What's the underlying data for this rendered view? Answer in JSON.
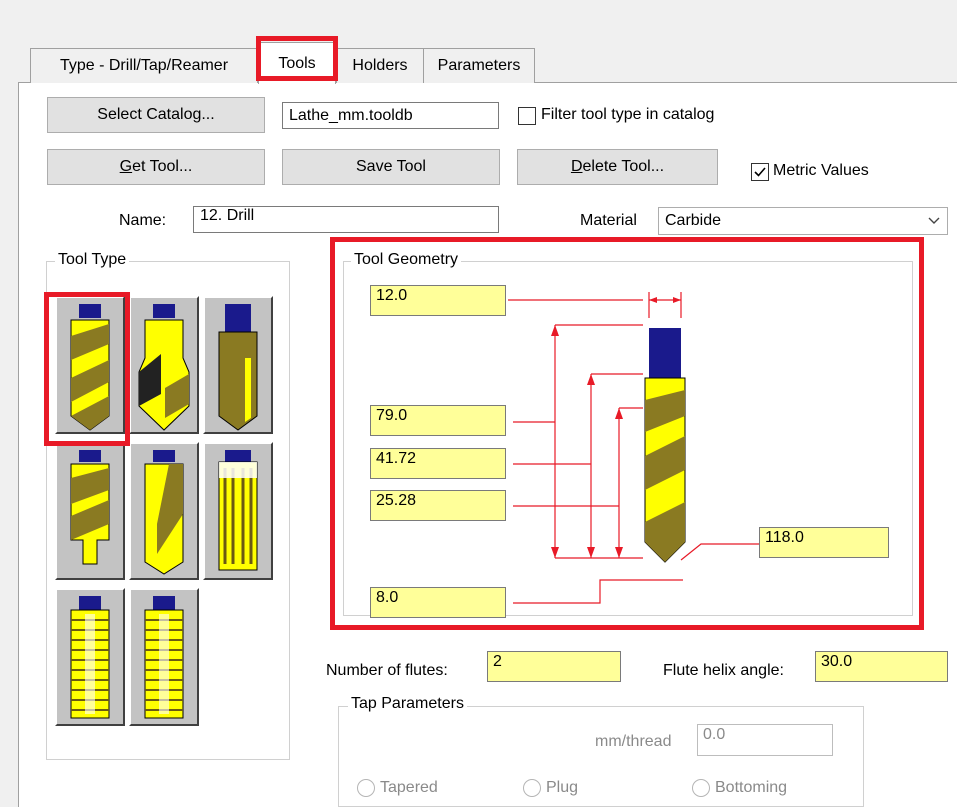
{
  "tabs": [
    {
      "label": "Type - Drill/Tap/Reamer"
    },
    {
      "label": "Tools"
    },
    {
      "label": "Holders"
    },
    {
      "label": "Parameters"
    }
  ],
  "active_tab": "Tools",
  "catalog": {
    "select_label": "Select Catalog...",
    "file_value": "Lathe_mm.tooldb",
    "filter_label": "Filter tool type in catalog",
    "filter_checked": false
  },
  "tool_actions": {
    "get_tool_label_rest": "et Tool...",
    "get_tool_accel": "G",
    "save_tool_label": "Save Tool",
    "delete_tool_accel": "D",
    "delete_tool_label_rest": "elete Tool...",
    "metric_label": "Metric Values",
    "metric_checked": true
  },
  "name": {
    "label": "Name:",
    "value": "12. Drill"
  },
  "material": {
    "label": "Material",
    "selected": "Carbide"
  },
  "tool_type": {
    "title": "Tool Type",
    "tiles": [
      {
        "icon": "drill-icon"
      },
      {
        "icon": "spot-drill-icon"
      },
      {
        "icon": "end-mill-icon"
      },
      {
        "icon": "step-drill-icon"
      },
      {
        "icon": "twist-drill-icon"
      },
      {
        "icon": "reamer-icon"
      },
      {
        "icon": "tap-icon"
      },
      {
        "icon": "tap-bottoming-icon"
      }
    ]
  },
  "geometry": {
    "title": "Tool Geometry",
    "diameter": "12.0",
    "overall_length": "79.0",
    "shoulder_length": "41.72",
    "flute_length": "25.28",
    "point_angle": "118.0",
    "tip_diameter": "8.0"
  },
  "flutes": {
    "count_label": "Number of flutes:",
    "count": "2",
    "helix_label": "Flute helix angle:",
    "helix": "30.0"
  },
  "tap": {
    "title": "Tap Parameters",
    "thread_label": "mm/thread",
    "thread_value": "0.0",
    "options": [
      {
        "label": "Tapered"
      },
      {
        "label": "Plug"
      },
      {
        "label": "Bottoming"
      }
    ]
  },
  "colors": {
    "highlight": "#e81a27",
    "field_yellow": "#ffff99",
    "drill_yellow": "#ffff00",
    "shank_blue": "#1a1a8c",
    "flute_olive": "#8a7a22"
  }
}
